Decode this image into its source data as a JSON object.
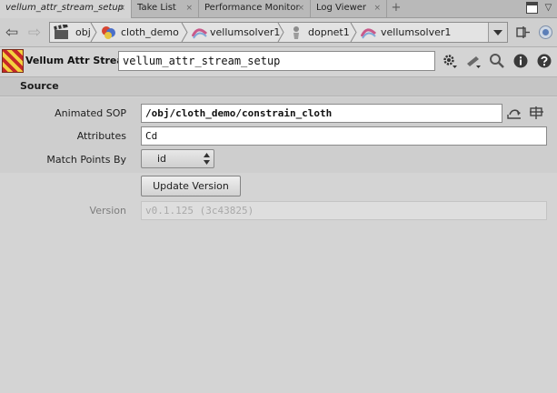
{
  "tabs": [
    {
      "label": "vellum_attr_stream_setup",
      "active": true,
      "close_glyph": "×"
    },
    {
      "label": "Take List",
      "close_glyph": "×"
    },
    {
      "label": "Performance Monitor",
      "close_glyph": "×"
    },
    {
      "label": "Log Viewer",
      "close_glyph": "×"
    }
  ],
  "tabbar": {
    "add_glyph": "+",
    "menu_glyph": "▽"
  },
  "path": {
    "back_glyph": "⇦",
    "forward_glyph": "⇨",
    "crumbs": [
      {
        "label": "obj",
        "icon": "clapper-icon"
      },
      {
        "label": "cloth_demo",
        "icon": "object-icon"
      },
      {
        "label": "vellumsolver1",
        "icon": "vellum-icon"
      },
      {
        "label": "dopnet1",
        "icon": "dop-icon"
      },
      {
        "label": "vellumsolver1",
        "icon": "vellum-icon"
      }
    ]
  },
  "node": {
    "type_label": "Vellum Attr Stream",
    "name": "vellum_attr_stream_setup"
  },
  "section": {
    "title": "Source"
  },
  "params": {
    "animated_sop": {
      "label": "Animated SOP",
      "value": "/obj/cloth_demo/constrain_cloth"
    },
    "attributes": {
      "label": "Attributes",
      "value": "Cd"
    },
    "match_points_by": {
      "label": "Match Points By",
      "value": "id"
    },
    "update_button": {
      "label": "Update Version"
    },
    "version": {
      "label": "Version",
      "value": "v0.1.125 (3c43825)"
    }
  },
  "colors": {
    "background": "#d4d4d4",
    "tabbar": "#b9b9b9",
    "section": "#c5c5c5",
    "field": "#ffffff"
  }
}
